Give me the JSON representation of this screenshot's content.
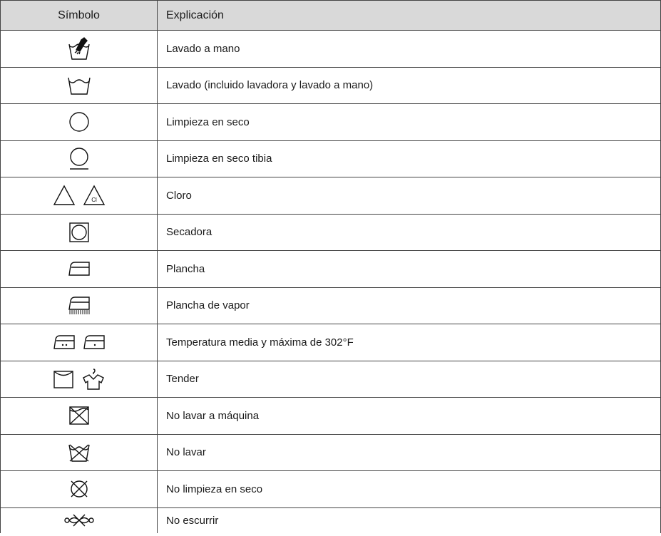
{
  "header": {
    "symbol": "Símbolo",
    "explanation": "Explicación"
  },
  "rows": [
    {
      "icon": "hand-wash-icon",
      "text": "Lavado a mano"
    },
    {
      "icon": "wash-tub-icon",
      "text": "Lavado (incluido lavadora y lavado a mano)"
    },
    {
      "icon": "dry-clean-circle-icon",
      "text": "Limpieza en seco"
    },
    {
      "icon": "dry-clean-mild-icon",
      "text": "Limpieza en seco tibia"
    },
    {
      "icon": "bleach-triangle-icon",
      "text": "Cloro",
      "cl_label": "Cl"
    },
    {
      "icon": "tumble-dry-icon",
      "text": "Secadora"
    },
    {
      "icon": "iron-icon",
      "text": "Plancha"
    },
    {
      "icon": "steam-iron-icon",
      "text": "Plancha de vapor"
    },
    {
      "icon": "iron-temperature-icon",
      "text": "Temperatura media y máxima de 302°F"
    },
    {
      "icon": "line-dry-icon",
      "text": "Tender"
    },
    {
      "icon": "no-machine-wash-icon",
      "text": "No lavar a máquina"
    },
    {
      "icon": "do-not-wash-icon",
      "text": "No lavar"
    },
    {
      "icon": "no-dry-clean-icon",
      "text": "No limpieza en seco"
    },
    {
      "icon": "do-not-wring-icon",
      "text": "No escurrir"
    }
  ]
}
